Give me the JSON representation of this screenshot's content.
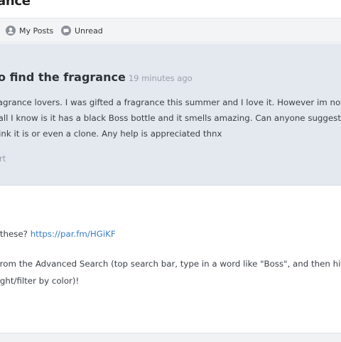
{
  "page": {
    "title": "ance"
  },
  "tabs": [
    {
      "label": "My Posts",
      "icon": "user-icon"
    },
    {
      "label": "Unread",
      "icon": "unread-icon"
    }
  ],
  "post": {
    "title": "o find the fragrance",
    "time": "19 minutes ago",
    "body_lines": [
      "Fragrance lovers. I was gifted a fragrance this summer and I love it. However im not",
      " it all I know is it has a black Boss bottle and it smells amazing. Can anyone suggest",
      "think it is or even a clone. Any help is appreciated thnx"
    ],
    "report_label": "ort"
  },
  "reply": {
    "line1_text": "f these? ",
    "line1_link": "https://par.fm/HGiKF",
    "line2": "  from the Advanced Search (top search bar, type in a word like \"Boss\", and then hit",
    "line3": " right/filter by color)!"
  }
}
